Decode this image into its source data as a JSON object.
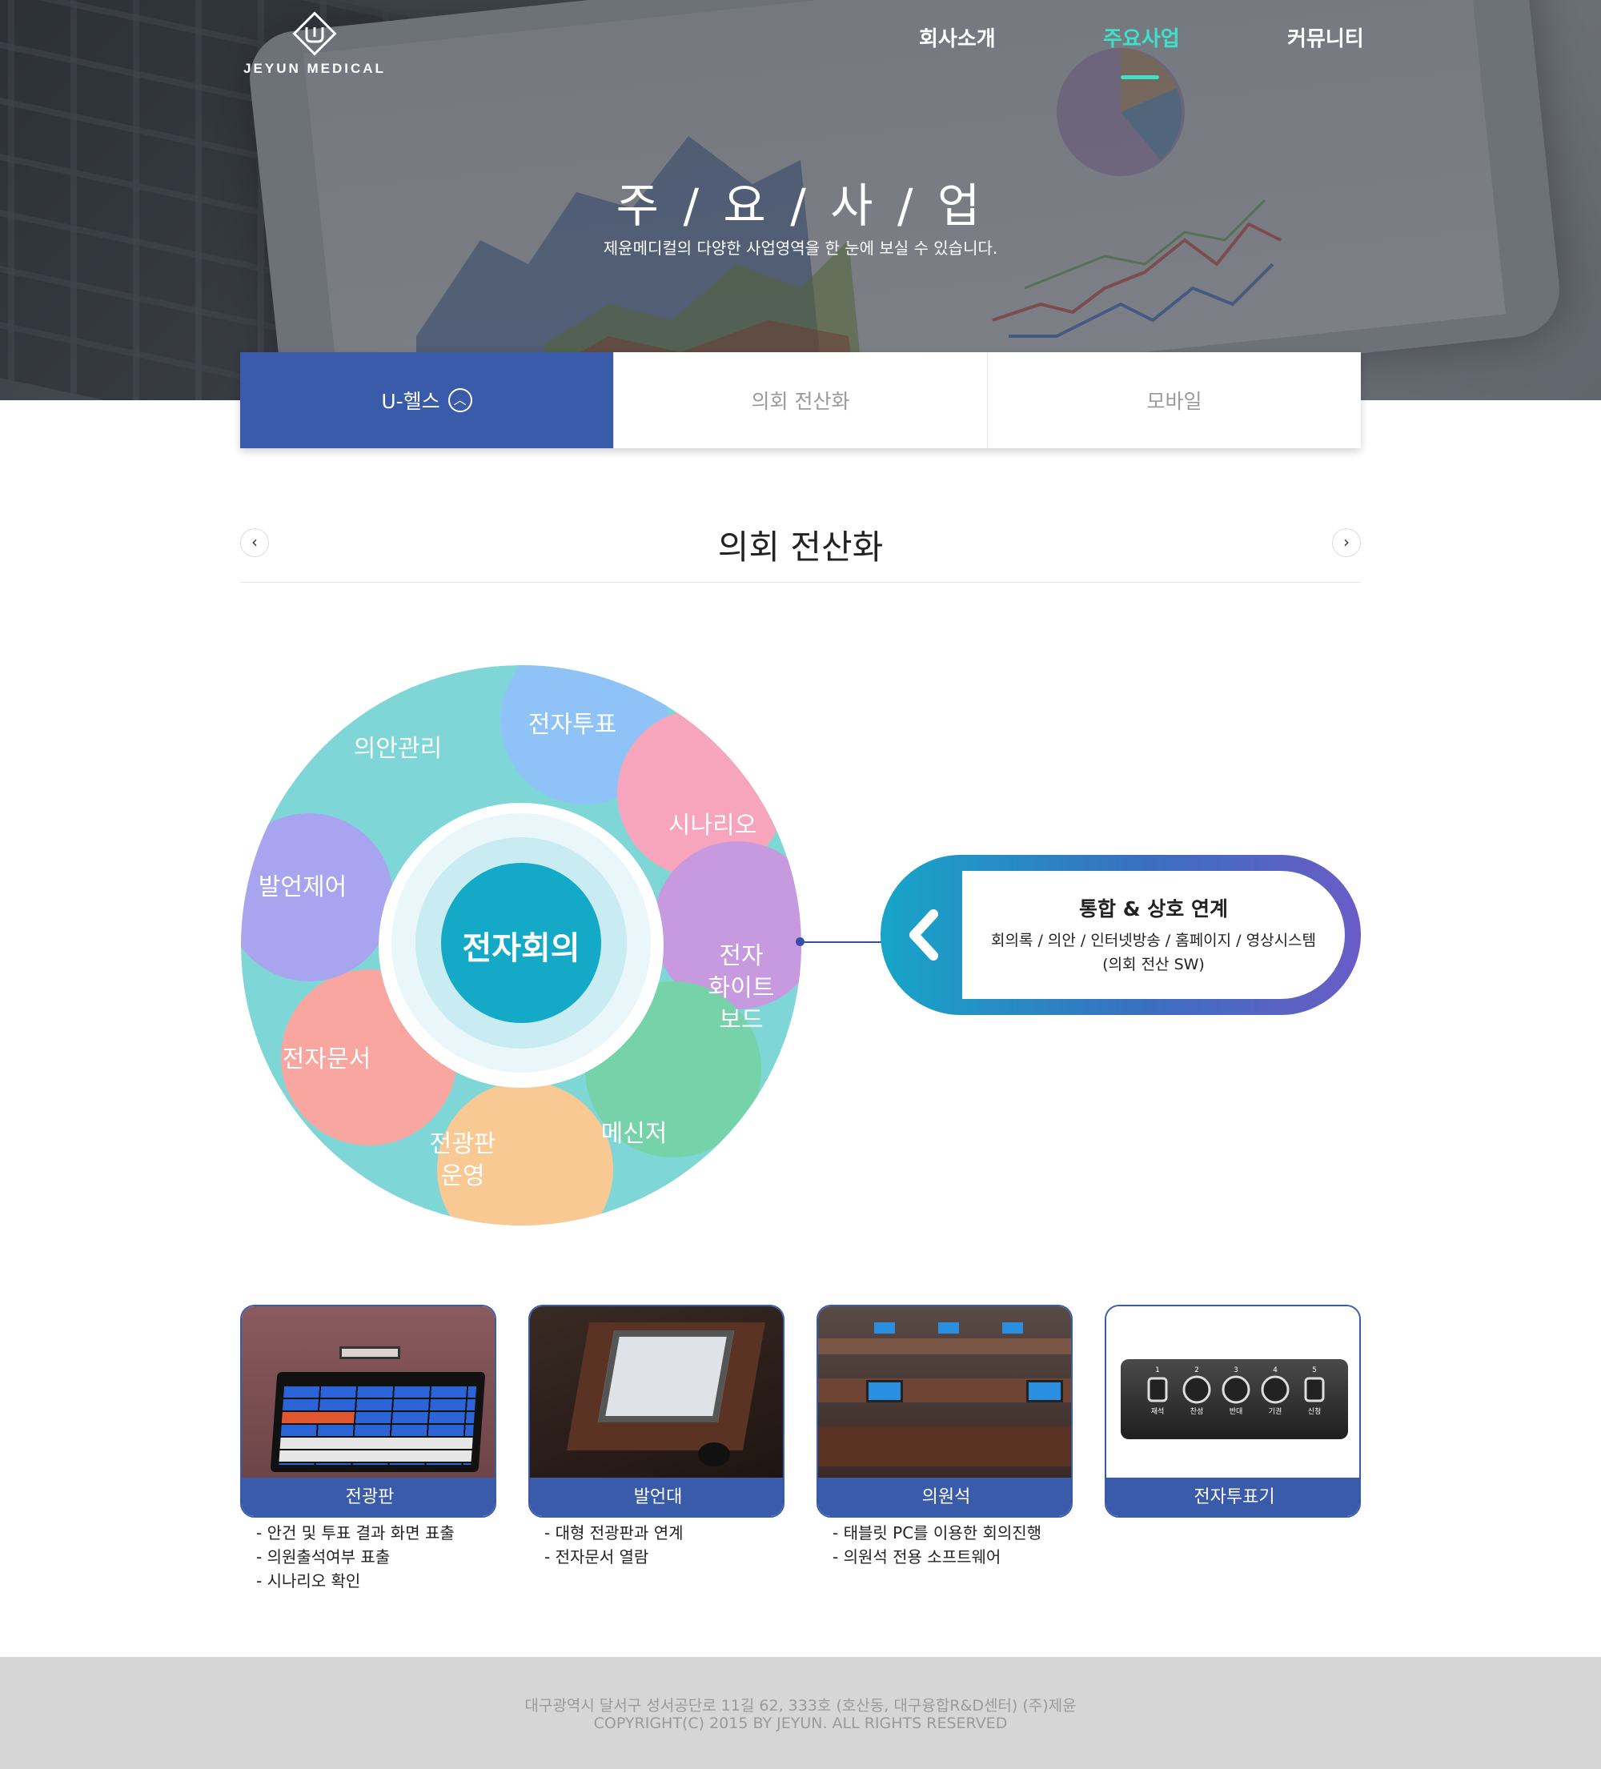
{
  "brand": {
    "name": "JEYUN MEDICAL"
  },
  "nav": {
    "items": [
      "회사소개",
      "주요사업",
      "커뮤니티"
    ],
    "active": "주요사업"
  },
  "hero": {
    "title": "주 / 요 / 사 / 업",
    "subtitle": "제윤메디컬의 다양한 사업영역을 한 눈에 보실 수 있습니다."
  },
  "tabs": [
    "U-헬스",
    "의회 전산화",
    "모바일"
  ],
  "section": {
    "title": "의회 전산화"
  },
  "diagram": {
    "center": "전자회의",
    "segments": [
      "전자투표",
      "시나리오",
      "전자 화이트 보드",
      "메신저",
      "전광판 운영",
      "전자문서",
      "발언제어",
      "의안관리"
    ],
    "labels": {
      "s1": "전자투표",
      "s2": "시나리오",
      "s3a": "전자",
      "s3b": "화이트",
      "s3c": "보드",
      "s4": "메신저",
      "s5a": "전광판",
      "s5b": "운영",
      "s6": "전자문서",
      "s7": "발언제어",
      "s8": "의안관리"
    },
    "colors": [
      "#8fc3f7",
      "#f7a5bd",
      "#c79ae0",
      "#76d2a8",
      "#f9c993",
      "#f9a6a1",
      "#a9a4f0",
      "#7fd6d6"
    ]
  },
  "callout": {
    "title": "통합 & 상호 연계",
    "line1": "회의록 / 의안 / 인터넷방송 / 홈페이지 / 영상시스템",
    "line2": "(의회 전산 SW)"
  },
  "cards": [
    {
      "title": "전광판",
      "desc": [
        "- 안건 및 투표 결과 화면 표출",
        "- 의원출석여부 표출",
        "- 시나리오 확인"
      ]
    },
    {
      "title": "발언대",
      "desc": [
        "- 대형 전광판과 연계",
        "- 전자문서 열람"
      ]
    },
    {
      "title": "의원석",
      "desc": [
        "- 태블릿 PC를 이용한 회의진행",
        "- 의원석 전용 소프트웨어"
      ]
    },
    {
      "title": "전자투표기",
      "desc": []
    }
  ],
  "voting_device": {
    "numbers": [
      "1",
      "2",
      "3",
      "4",
      "5"
    ],
    "labels": [
      "재석",
      "찬성",
      "반대",
      "기권",
      "신청"
    ]
  },
  "footer": {
    "address": "대구광역시 달서구 성서공단로 11길 62, 333호 (호산동, 대구융합R&D센터) (주)제윤",
    "copyright": "COPYRIGHT(C) 2015 BY JEYUN. ALL RIGHTS RESERVED"
  }
}
